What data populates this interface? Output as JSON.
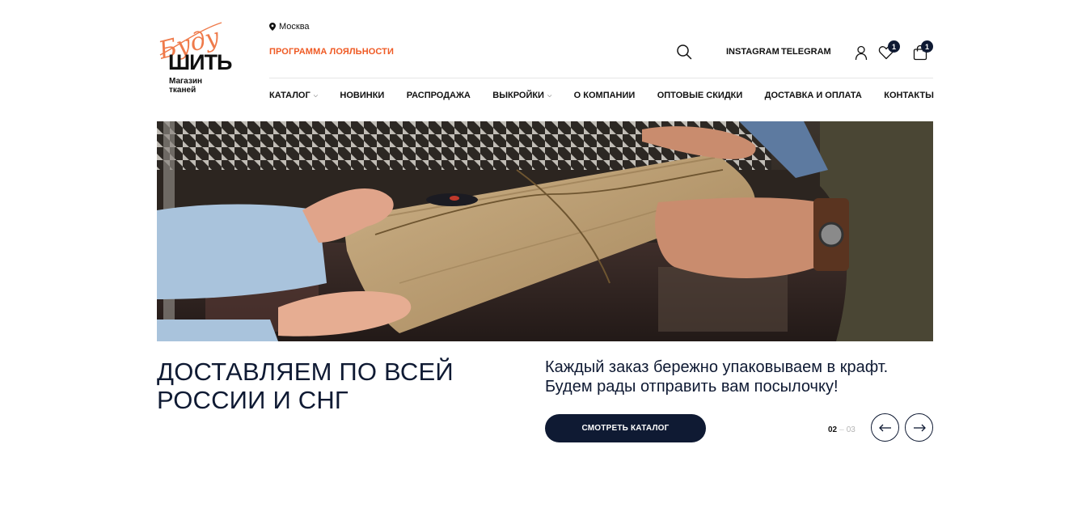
{
  "logo": {
    "script_text": "Буду",
    "main_text": "ШИТЬ",
    "sub_line1": "Магазин",
    "sub_line2": "тканей",
    "accent_color": "#ef7a4a"
  },
  "header": {
    "city": "Москва",
    "loyalty_label": "ПРОГРАММА ЛОЯЛЬНОСТИ",
    "loyalty_color": "#ef5a24",
    "social": [
      "INSTAGRAM",
      "TELEGRAM"
    ],
    "favorites_count": "1",
    "cart_count": "1",
    "icons": [
      "location-pin-icon",
      "search-icon",
      "user-icon",
      "heart-icon",
      "bag-icon"
    ]
  },
  "nav": {
    "items": [
      {
        "label": "КАТАЛОГ",
        "dropdown": true
      },
      {
        "label": "НОВИНКИ",
        "dropdown": false
      },
      {
        "label": "РАСПРОДАЖА",
        "dropdown": false
      },
      {
        "label": "ВЫКРОЙКИ",
        "dropdown": true
      },
      {
        "label": "О КОМПАНИИ",
        "dropdown": false
      },
      {
        "label": "ОПТОВЫЕ СКИДКИ",
        "dropdown": false
      },
      {
        "label": "ДОСТАВКА И ОПЛАТА",
        "dropdown": false
      },
      {
        "label": "КОНТАКТЫ",
        "dropdown": false
      }
    ]
  },
  "slide": {
    "headline_line1": "ДОСТАВЛЯЕМ ПО ВСЕЙ",
    "headline_line2": "РОССИИ И СНГ",
    "desc_line1": "Каждый заказ бережно упаковываем в крафт.",
    "desc_line2": "Будем рады отправить вам посылочку!",
    "cta_label": "СМОТРЕТЬ КАТАЛОГ",
    "current": "02",
    "separator": "–",
    "total": "03"
  },
  "colors": {
    "brand_dark": "#0f1a33",
    "kraft": "#b8996a"
  }
}
